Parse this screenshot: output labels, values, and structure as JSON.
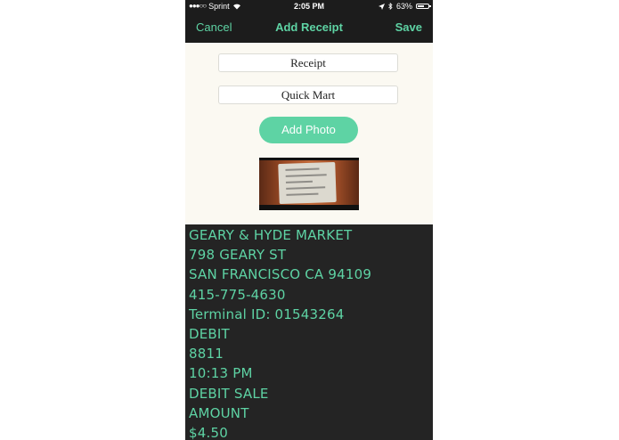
{
  "status_bar": {
    "carrier": "Sprint",
    "signal_dots": "●●●○○",
    "time": "2:05 PM",
    "battery_percent": "63%",
    "battery_level": 0.63
  },
  "nav": {
    "cancel_label": "Cancel",
    "title": "Add Receipt",
    "save_label": "Save"
  },
  "form": {
    "type_value": "Receipt",
    "merchant_value": "Quick Mart",
    "add_photo_label": "Add Photo"
  },
  "ocr_text": [
    "GEARY & HYDE MARKET",
    "798 GEARY ST",
    "SAN FRANCISCO CA 94109",
    "415-775-4630",
    "Terminal ID: 01543264",
    "DEBIT",
    "8811",
    "10:13 PM",
    "DEBIT SALE",
    "AMOUNT",
    "$4.50"
  ],
  "colors": {
    "accent": "#5ed3a4",
    "nav_background": "#1c1c1c",
    "form_background": "#fbf9f2",
    "ocr_background": "#242424"
  },
  "icons": {
    "signal": "signal-dots-icon",
    "wifi": "wifi-icon",
    "location": "location-arrow-icon",
    "bluetooth": "bluetooth-icon",
    "battery": "battery-icon"
  }
}
